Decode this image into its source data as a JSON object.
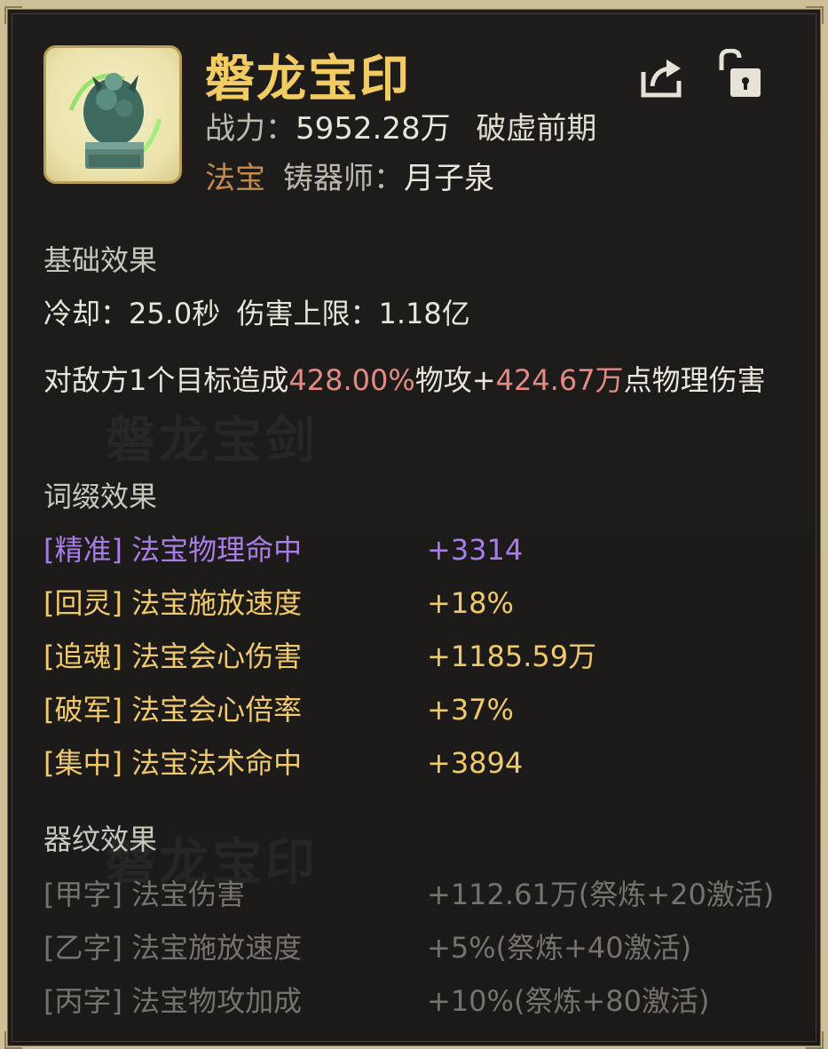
{
  "item": {
    "name": "磐龙宝印",
    "power_label": "战力：",
    "power_value": "5952.28万",
    "realm": "破虚前期",
    "type": "法宝",
    "crafter_label": "铸器师：",
    "crafter": "月子泉"
  },
  "base": {
    "title": "基础效果",
    "cooldown_label": "冷却：",
    "cooldown_value": "25.0秒",
    "damage_cap_label": "伤害上限：",
    "damage_cap_value": "1.18亿",
    "desc_1": "对敌方1个目标造成",
    "desc_pct": "428.00%",
    "desc_2": "物攻+",
    "desc_flat": "424.67万",
    "desc_3": "点物理伤害"
  },
  "affix": {
    "title": "词缀效果",
    "rows": [
      {
        "label": "[精准] 法宝物理命中",
        "value": "+3314"
      },
      {
        "label": "[回灵] 法宝施放速度",
        "value": "+18%"
      },
      {
        "label": "[追魂] 法宝会心伤害",
        "value": "+1185.59万"
      },
      {
        "label": "[破军] 法宝会心倍率",
        "value": "+37%"
      },
      {
        "label": "[集中] 法宝法术命中",
        "value": "+3894"
      }
    ]
  },
  "inscription": {
    "title": "器纹效果",
    "rows": [
      {
        "label": "[甲字] 法宝伤害",
        "value": "+112.61万(祭炼+20激活)"
      },
      {
        "label": "[乙字] 法宝施放速度",
        "value": "+5%(祭炼+40激活)"
      },
      {
        "label": "[丙字] 法宝物攻加成",
        "value": "+10%(祭炼+80激活)"
      }
    ]
  },
  "icons": {
    "item": "jade-dragon-seal-icon",
    "share": "share-icon",
    "lock": "unlocked-padlock-icon"
  },
  "colors": {
    "title": "#f2cb62",
    "type": "#c38b4c",
    "highlight": "#e58a83",
    "purple_affix": "#a97de6",
    "gold_affix": "#f0c96b",
    "inactive": "#77726b"
  }
}
